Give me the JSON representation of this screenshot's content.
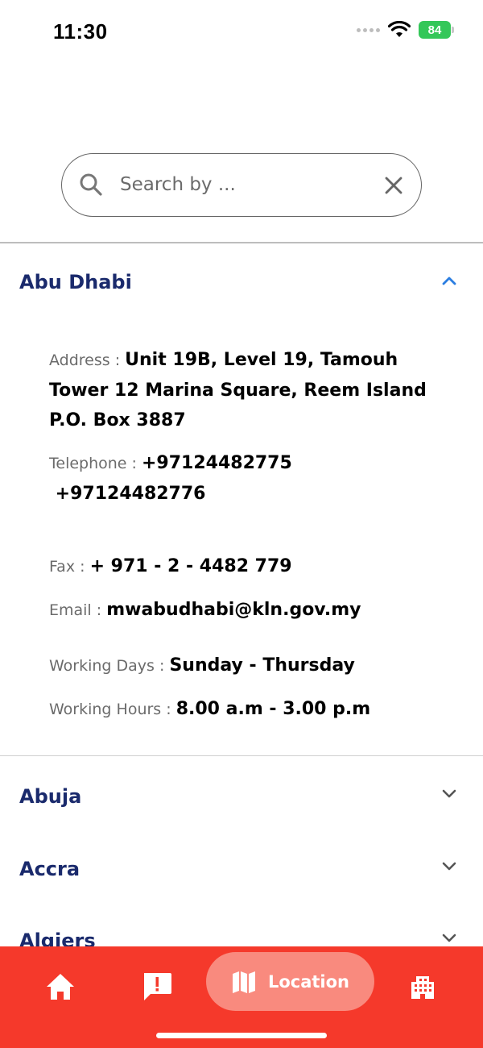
{
  "status_bar": {
    "time": "11:30",
    "battery": "84"
  },
  "search": {
    "placeholder": "Search by ..."
  },
  "accordion": {
    "expanded": {
      "title": "Abu Dhabi",
      "address_label": "Address : ",
      "address_line1": "Unit 19B, Level 19, Tamouh",
      "address_line2": "Tower 12 Marina Square, Reem Island",
      "address_line3": "P.O. Box 3887",
      "telephone_label": "Telephone : ",
      "telephone_1": "+97124482775",
      "telephone_2": " +97124482776",
      "fax_label": "Fax : ",
      "fax": "+ 971 - 2 - 4482 779",
      "email_label": "Email : ",
      "email": "mwabudhabi@kln.gov.my",
      "working_days_label": "Working Days : ",
      "working_days": "Sunday - Thursday",
      "working_hours_label": "Working Hours : ",
      "working_hours": "8.00 a.m - 3.00 p.m"
    },
    "collapsed": [
      "Abuja",
      "Accra",
      "Algiers"
    ]
  },
  "tab_bar": {
    "tabs": [
      {
        "icon": "home-icon"
      },
      {
        "icon": "alert-icon"
      },
      {
        "icon": "map-icon",
        "label": "Location",
        "active": true
      },
      {
        "icon": "building-icon"
      }
    ]
  },
  "colors": {
    "accent": "#f5392b",
    "active_tab": "#f98a7e",
    "title": "#1a2a6c",
    "chevron_up": "#2a7de1"
  }
}
